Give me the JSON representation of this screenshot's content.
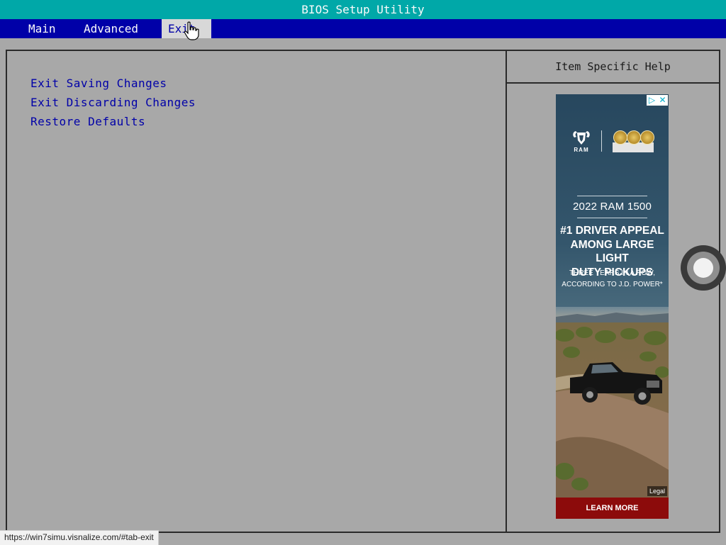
{
  "window": {
    "title": "BIOS Setup Utility"
  },
  "menu": {
    "tabs": [
      {
        "label": "Main",
        "active": false
      },
      {
        "label": "Advanced",
        "active": false
      },
      {
        "label": "Exit",
        "active": true
      }
    ]
  },
  "main": {
    "options": [
      {
        "label": "Exit Saving Changes"
      },
      {
        "label": "Exit Discarding Changes"
      },
      {
        "label": "Restore Defaults"
      }
    ]
  },
  "help": {
    "title": "Item Specific Help"
  },
  "ad": {
    "brand": "RAM",
    "year_model": "2022 RAM 1500",
    "headline_lines": [
      "#1 DRIVER APPEAL",
      "AMONG LARGE LIGHT",
      "DUTY PICKUPS"
    ],
    "sub_lines": [
      "THREE YEARS IN A ROW,",
      "ACCORDING TO J.D. POWER*"
    ],
    "legal": "Legal",
    "cta": "LEARN MORE",
    "adchoices_icon": "adchoices-icon",
    "close_icon": "close-icon",
    "cta_color": "#8c0b0b"
  },
  "status_bar": {
    "url": "https://win7simu.visnalize.com/#tab-exit"
  },
  "colors": {
    "title_bar": "#00a8a8",
    "menu_bar": "#0000a8",
    "background": "#a8a8a8",
    "option_text": "#0000a8"
  }
}
